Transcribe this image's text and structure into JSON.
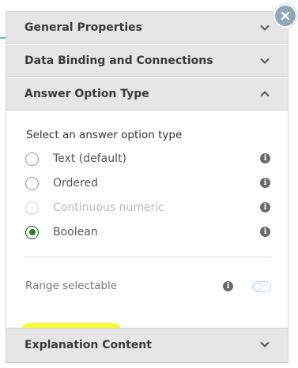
{
  "panel": {
    "close_icon": "close-icon",
    "accent_color": "#8fa9b8",
    "sections": [
      {
        "title": "General Properties",
        "state": "collapsed"
      },
      {
        "title": "Data Binding and Connections",
        "state": "collapsed"
      },
      {
        "title": "Answer Option Type",
        "state": "expanded"
      },
      {
        "title": "Explanation Content",
        "state": "collapsed"
      }
    ]
  },
  "answer_option_type": {
    "prompt": "Select an answer option type",
    "options": [
      {
        "label": "Text (default)",
        "selected": false,
        "disabled": false
      },
      {
        "label": "Ordered",
        "selected": false,
        "disabled": false
      },
      {
        "label": "Continuous numeric",
        "selected": false,
        "disabled": true
      },
      {
        "label": "Boolean",
        "selected": true,
        "disabled": false
      }
    ],
    "highlight_color": "#f5ff2a",
    "range_selectable": {
      "label": "Range selectable",
      "enabled": false
    }
  }
}
